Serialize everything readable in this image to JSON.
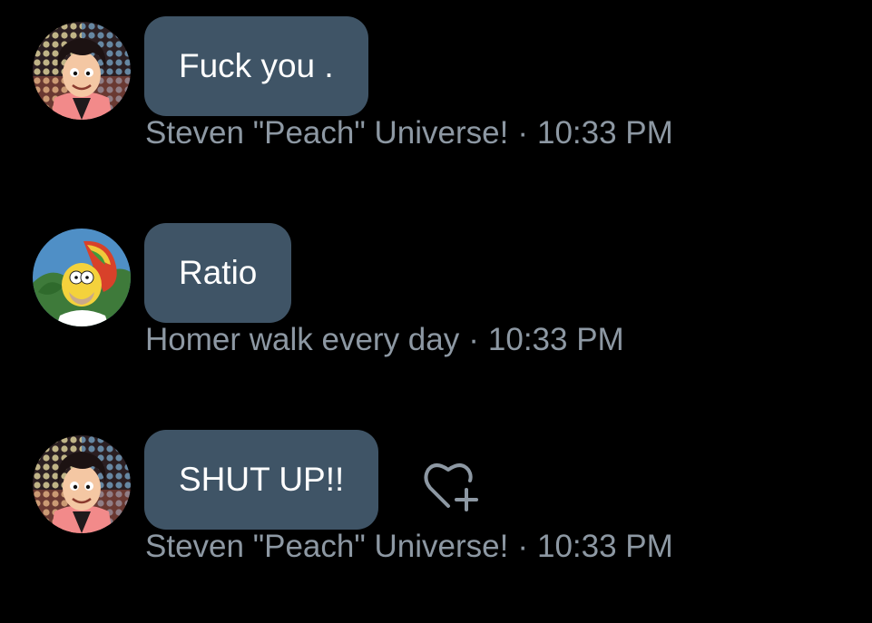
{
  "messages": [
    {
      "text": "Fuck you .",
      "author": "Steven \"Peach\" Universe!",
      "separator": "·",
      "time": "10:33 PM",
      "avatar": "steven-avatar"
    },
    {
      "text": "Ratio",
      "author": "Homer walk every day",
      "separator": "·",
      "time": "10:33 PM",
      "avatar": "homer-avatar"
    },
    {
      "text": "SHUT UP!!",
      "author": "Steven \"Peach\" Universe!",
      "separator": "·",
      "time": "10:33 PM",
      "avatar": "steven-avatar"
    }
  ],
  "react_icon": "heart-add-icon",
  "colors": {
    "background": "#000000",
    "bubble": "#3f5466",
    "message_text": "#ffffff",
    "meta_text": "#8d98a3"
  }
}
